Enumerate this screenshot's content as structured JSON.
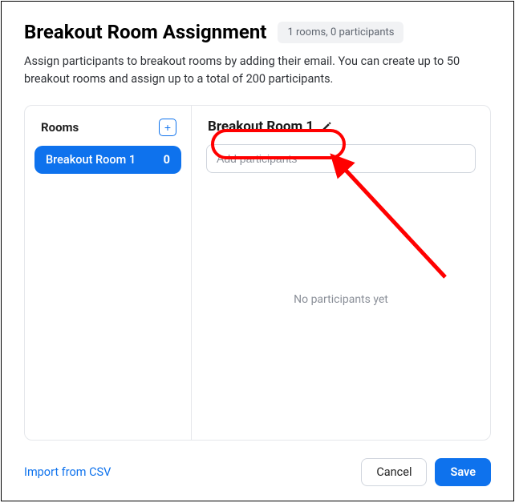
{
  "header": {
    "title": "Breakout Room Assignment",
    "badge": "1 rooms, 0 participants"
  },
  "description": "Assign participants to breakout rooms by adding their email. You can create up to 50 breakout rooms and assign up to a total of 200 participants.",
  "rooms": {
    "label": "Rooms",
    "add_icon": "+",
    "items": [
      {
        "name": "Breakout Room 1",
        "count": "0"
      }
    ]
  },
  "detail": {
    "title": "Breakout Room 1",
    "input_placeholder": "Add participants",
    "empty_text": "No participants yet"
  },
  "footer": {
    "import_label": "Import from CSV",
    "cancel_label": "Cancel",
    "save_label": "Save"
  }
}
